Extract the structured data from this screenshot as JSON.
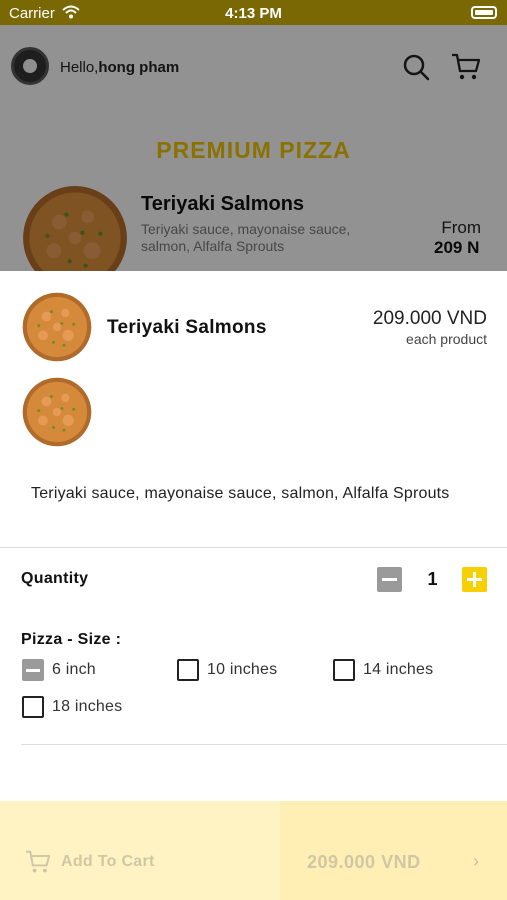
{
  "status_bar": {
    "carrier": "Carrier",
    "time": "4:13 PM"
  },
  "header": {
    "greeting_prefix": "Hello,",
    "user_name": "hong pham"
  },
  "section": {
    "title": "PREMIUM PIZZA"
  },
  "background_item": {
    "name": "Teriyaki Salmons",
    "description": "Teriyaki sauce, mayonaise sauce, salmon, Alfalfa Sprouts",
    "from_label": "From",
    "price": "209 N"
  },
  "product": {
    "name": "Teriyaki Salmons",
    "price": "209.000 VND",
    "price_note": "each product",
    "description": "Teriyaki sauce, mayonaise sauce, salmon, Alfalfa Sprouts"
  },
  "quantity": {
    "label": "Quantity",
    "value": "1"
  },
  "size": {
    "label": "Pizza - Size :",
    "options": [
      {
        "label": "6 inch",
        "selected": true
      },
      {
        "label": "10 inches",
        "selected": false
      },
      {
        "label": "14 inches",
        "selected": false
      },
      {
        "label": "18 inches",
        "selected": false
      }
    ]
  },
  "bottom_bar": {
    "add_to_cart_label": "Add To Cart",
    "total": "209.000 VND",
    "chevron": "›"
  },
  "colors": {
    "accent_yellow": "#f6d000",
    "title_yellow": "#e8bc00",
    "bar_bg": "#fff3c4"
  },
  "icons": [
    "wifi-icon",
    "battery-icon",
    "search-icon",
    "cart-icon",
    "minus-icon",
    "plus-icon",
    "chevron-right-icon"
  ]
}
